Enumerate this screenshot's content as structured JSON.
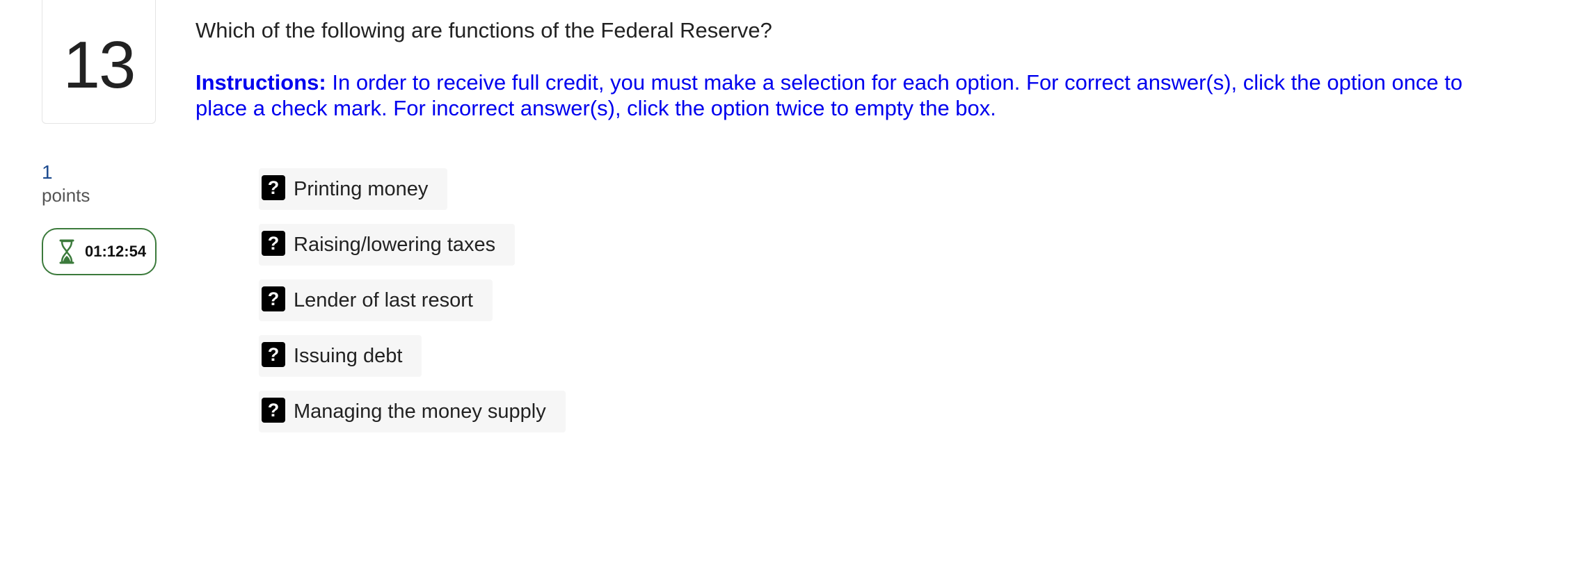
{
  "question": {
    "number": "13",
    "text": "Which of the following are functions of the Federal Reserve?",
    "instructions_label": "Instructions:",
    "instructions_text": " In order to receive full credit, you must make a selection for each option. For correct answer(s), click the option once to place a check mark. For incorrect answer(s), click the option twice to empty the box."
  },
  "points": {
    "value": "1",
    "label": "points"
  },
  "timer": {
    "icon": "hourglass-icon",
    "time": "01:12:54",
    "color": "#3b7a3b"
  },
  "options": [
    {
      "label": "Printing money",
      "state": "?"
    },
    {
      "label": "Raising/lowering taxes",
      "state": "?"
    },
    {
      "label": "Lender of last resort",
      "state": "?"
    },
    {
      "label": "Issuing debt",
      "state": "?"
    },
    {
      "label": "Managing the money supply",
      "state": "?"
    }
  ],
  "colors": {
    "instructions": "#0000ee",
    "points_value": "#1d4b8f",
    "option_bg": "#f6f6f6"
  }
}
